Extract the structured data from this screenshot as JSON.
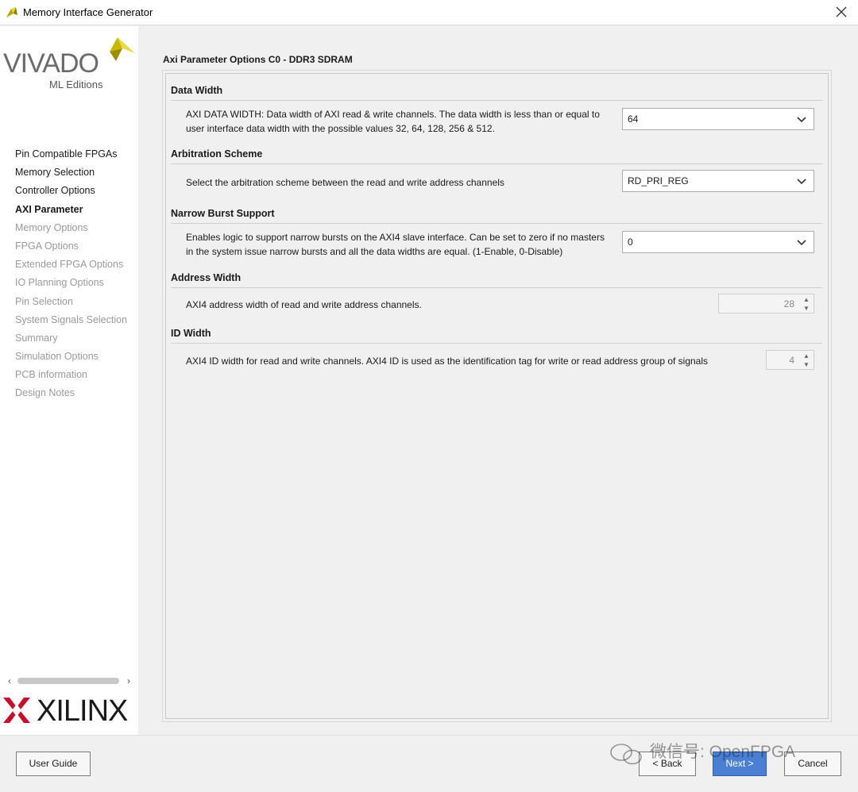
{
  "window": {
    "title": "Memory Interface Generator",
    "icons": {
      "app": "vivado-app-icon",
      "close": "close-icon"
    }
  },
  "sidebar": {
    "vivado_logo": {
      "word": "VIVADO",
      "registered": "®",
      "edition": "ML Editions"
    },
    "items": [
      {
        "label": "Pin Compatible FPGAs",
        "state": "normal"
      },
      {
        "label": "Memory Selection",
        "state": "normal"
      },
      {
        "label": "Controller Options",
        "state": "normal"
      },
      {
        "label": "AXI Parameter",
        "state": "active"
      },
      {
        "label": "Memory Options",
        "state": "disabled"
      },
      {
        "label": "FPGA Options",
        "state": "disabled"
      },
      {
        "label": "Extended FPGA Options",
        "state": "disabled"
      },
      {
        "label": "IO Planning Options",
        "state": "disabled"
      },
      {
        "label": "Pin Selection",
        "state": "disabled"
      },
      {
        "label": "System Signals Selection",
        "state": "disabled"
      },
      {
        "label": "Summary",
        "state": "disabled"
      },
      {
        "label": "Simulation Options",
        "state": "disabled"
      },
      {
        "label": "PCB information",
        "state": "disabled"
      },
      {
        "label": "Design Notes",
        "state": "disabled"
      }
    ],
    "xilinx_logo": {
      "word": "XILINX",
      "registered": "®"
    }
  },
  "main": {
    "title": "Axi Parameter Options C0 - DDR3 SDRAM",
    "sections": {
      "data_width": {
        "title": "Data Width",
        "desc_line1": "AXI DATA WIDTH: Data width of AXI read & write channels. The data width is less than or equal to",
        "desc_line2": "user interface data width with the possible values 32, 64, 128, 256 & 512.",
        "value": "64"
      },
      "arbitration": {
        "title": "Arbitration Scheme",
        "desc": "Select the arbitration scheme between the read and write address channels",
        "value": "RD_PRI_REG"
      },
      "narrow_burst": {
        "title": "Narrow Burst Support",
        "desc_line1": "Enables logic to support narrow bursts on the AXI4 slave interface. Can be set to zero if no masters",
        "desc_line2": "in the system issue narrow bursts and all the data widths are equal. (1-Enable, 0-Disable)",
        "value": "0"
      },
      "address_width": {
        "title": "Address Width",
        "desc": "AXI4 address width of read and write address channels.",
        "value": "28"
      },
      "id_width": {
        "title": "ID Width",
        "desc": "AXI4 ID width for read and write channels. AXI4 ID is used as the identification tag for write or read address group of signals",
        "value": "4"
      }
    }
  },
  "footer": {
    "user_guide": "User Guide",
    "back": "< Back",
    "next": "Next >",
    "cancel": "Cancel",
    "watermark": "微信号: OpenFPGA"
  },
  "colors": {
    "accent": "#4a7fd4",
    "xilinx_red": "#c8102e",
    "vivado_leaf": "#c9b800"
  }
}
